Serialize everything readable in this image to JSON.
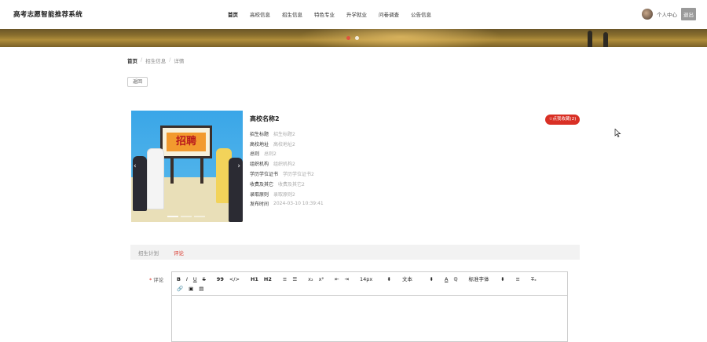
{
  "header": {
    "site_title": "高考志愿智能推荐系统",
    "nav": [
      "首页",
      "高校信息",
      "招生信息",
      "特色专业",
      "升学就业",
      "问卷调查",
      "公告信息"
    ],
    "active_nav_index": 0,
    "user_link": "个人中心",
    "logout": "退出"
  },
  "breadcrumb": {
    "home": "首页",
    "separator": "/",
    "section": "招生信息",
    "current": "详情"
  },
  "back_button": "返回",
  "detail": {
    "image_caption": "招聘",
    "school_name": "高校名称2",
    "collect_button": "☆点我收藏(2)",
    "fields": [
      {
        "label": "招生标题",
        "value": "招生标题2"
      },
      {
        "label": "高校地址",
        "value": "高校地址2"
      },
      {
        "label": "总则",
        "value": "总则2"
      },
      {
        "label": "组织机构",
        "value": "组织机构2"
      },
      {
        "label": "学历学位证书",
        "value": "学历学位证书2"
      },
      {
        "label": "收费及其它",
        "value": "收费及其它2"
      },
      {
        "label": "录取原则",
        "value": "录取原则2"
      },
      {
        "label": "发布时间",
        "value": "2024-03-10 10:39:41"
      }
    ]
  },
  "tabs": {
    "items": [
      "招生计划",
      "评论"
    ],
    "active_index": 1
  },
  "comment": {
    "required_mark": "*",
    "label": "评论"
  },
  "editor": {
    "row1": {
      "bold": "B",
      "italic": "I",
      "underline": "U",
      "strike": "S",
      "quote": "99",
      "code": "</>",
      "h1": "H1",
      "h2": "H2",
      "ordered_list": "≡",
      "bullet_list": "☰",
      "subscript": "x₂",
      "superscript": "x²",
      "outdent": "⇤",
      "indent": "⇥",
      "font_size": "14px",
      "heading": "文本",
      "font_color": "A",
      "bg_color": "ℚ",
      "font_family": "标准字体",
      "align": "≡",
      "clear": "T̶ₓ"
    },
    "row2": {
      "link": "🔗",
      "image": "▣",
      "video": "▤"
    },
    "select_arrow": "⬍"
  },
  "colors": {
    "accent": "#d93025",
    "tab_bg": "#f2f2f2",
    "logout_bg": "#9a9a9a"
  }
}
